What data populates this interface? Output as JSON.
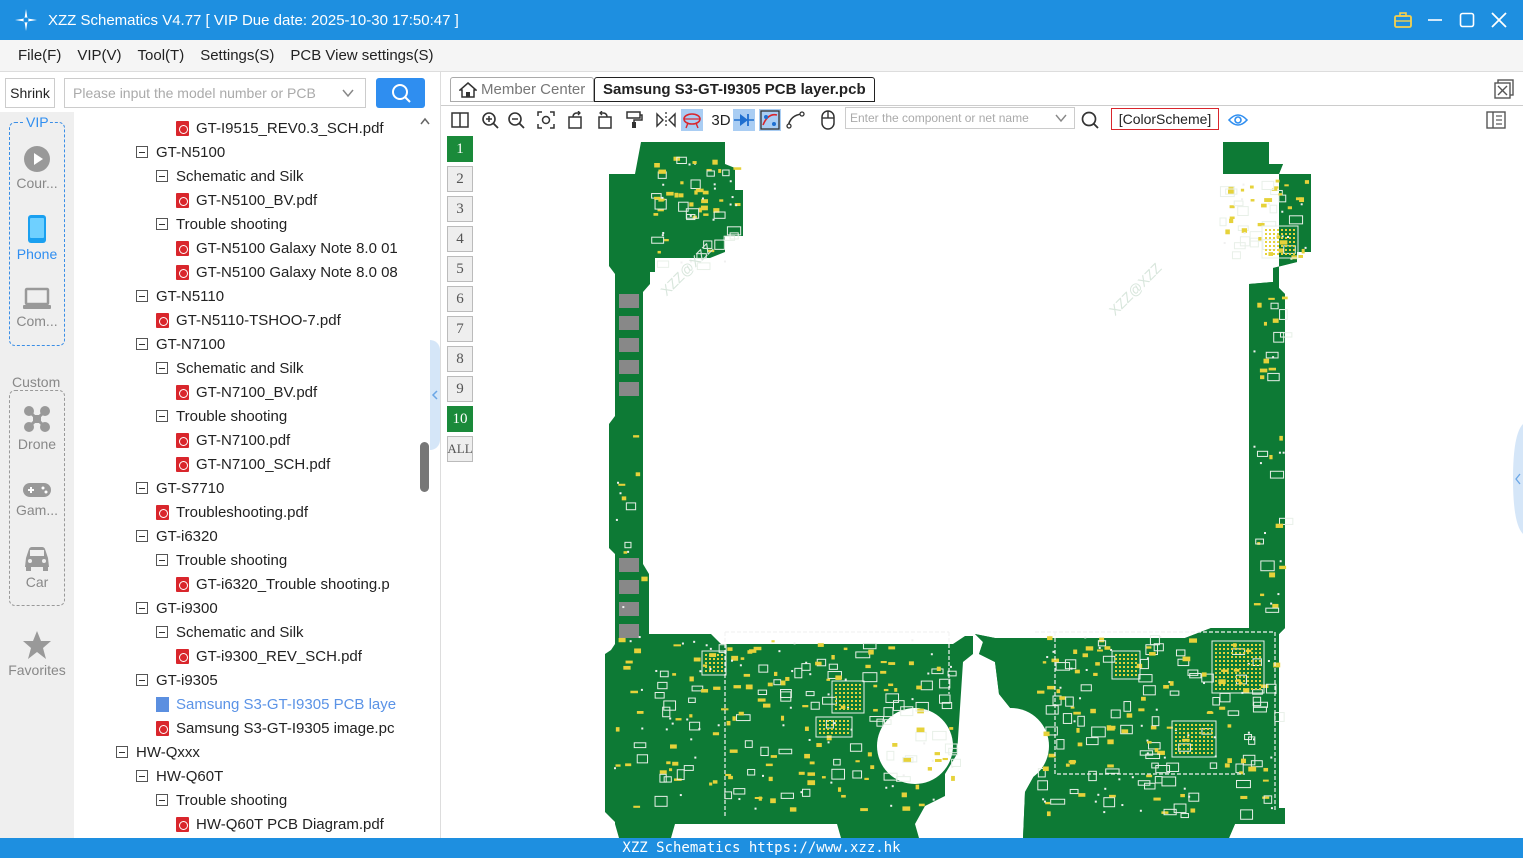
{
  "window": {
    "title": "XZZ Schematics V4.77 [ VIP Due date: 2025-10-30 17:50:47 ]"
  },
  "menu": [
    "File(F)",
    "VIP(V)",
    "Tool(T)",
    "Settings(S)",
    "PCB View settings(S)"
  ],
  "left": {
    "shrink_label": "Shrink",
    "search_placeholder": "Please input the model number or PCB",
    "vip_label": "VIP",
    "custom_label": "Custom",
    "categories": [
      {
        "label": "Cour...",
        "icon": "play-icon"
      },
      {
        "label": "Phone",
        "icon": "phone-icon"
      },
      {
        "label": "Com...",
        "icon": "laptop-icon"
      },
      {
        "label": "Drone",
        "icon": "drone-icon"
      },
      {
        "label": "Gam...",
        "icon": "gamepad-icon"
      },
      {
        "label": "Car",
        "icon": "car-icon"
      },
      {
        "label": "Favorites",
        "icon": "star-icon"
      }
    ],
    "tree": [
      {
        "text": "GT-I9515_REV0.3_SCH.pdf",
        "level": 3,
        "kind": "pdf"
      },
      {
        "text": "GT-N5100",
        "level": 1,
        "kind": "folder"
      },
      {
        "text": "Schematic and Silk",
        "level": 2,
        "kind": "folder"
      },
      {
        "text": "GT-N5100_BV.pdf",
        "level": 3,
        "kind": "pdf"
      },
      {
        "text": "Trouble shooting",
        "level": 2,
        "kind": "folder"
      },
      {
        "text": "GT-N5100 Galaxy Note 8.0 01",
        "level": 3,
        "kind": "pdf"
      },
      {
        "text": "GT-N5100 Galaxy Note 8.0 08",
        "level": 3,
        "kind": "pdf"
      },
      {
        "text": "GT-N5110",
        "level": 1,
        "kind": "folder"
      },
      {
        "text": "GT-N5110-TSHOO-7.pdf",
        "level": 2,
        "kind": "pdf"
      },
      {
        "text": "GT-N7100",
        "level": 1,
        "kind": "folder"
      },
      {
        "text": "Schematic and Silk",
        "level": 2,
        "kind": "folder"
      },
      {
        "text": "GT-N7100_BV.pdf",
        "level": 3,
        "kind": "pdf"
      },
      {
        "text": "Trouble shooting",
        "level": 2,
        "kind": "folder"
      },
      {
        "text": "GT-N7100.pdf",
        "level": 3,
        "kind": "pdf"
      },
      {
        "text": "GT-N7100_SCH.pdf",
        "level": 3,
        "kind": "pdf"
      },
      {
        "text": "GT-S7710",
        "level": 1,
        "kind": "folder"
      },
      {
        "text": "Troubleshooting.pdf",
        "level": 2,
        "kind": "pdf"
      },
      {
        "text": "GT-i6320",
        "level": 1,
        "kind": "folder"
      },
      {
        "text": "Trouble shooting",
        "level": 2,
        "kind": "folder"
      },
      {
        "text": "GT-i6320_Trouble shooting.p",
        "level": 3,
        "kind": "pdf"
      },
      {
        "text": "GT-i9300",
        "level": 1,
        "kind": "folder"
      },
      {
        "text": "Schematic and Silk",
        "level": 2,
        "kind": "folder"
      },
      {
        "text": "GT-i9300_REV_SCH.pdf",
        "level": 3,
        "kind": "pdf"
      },
      {
        "text": "GT-i9305",
        "level": 1,
        "kind": "folder"
      },
      {
        "text": "Samsung S3-GT-I9305 PCB laye",
        "level": 2,
        "kind": "pcb",
        "selected": true
      },
      {
        "text": "Samsung S3-GT-I9305 image.pc",
        "level": 2,
        "kind": "pdf"
      },
      {
        "text": "HW-Qxxx",
        "level": 0,
        "kind": "folder"
      },
      {
        "text": "HW-Q60T",
        "level": 1,
        "kind": "folder"
      },
      {
        "text": "Trouble shooting",
        "level": 2,
        "kind": "folder"
      },
      {
        "text": "HW-Q60T PCB Diagram.pdf",
        "level": 3,
        "kind": "pdf"
      }
    ]
  },
  "tabs": {
    "member_center": "Member Center",
    "active": "Samsung S3-GT-I9305 PCB layer.pcb"
  },
  "toolbar": {
    "label_3d": "3D",
    "search_placeholder": "Enter the component or net name",
    "color_scheme": "[ColorScheme]"
  },
  "layers": [
    "1",
    "2",
    "3",
    "4",
    "5",
    "6",
    "7",
    "8",
    "9",
    "10",
    "ALL"
  ],
  "canvas": {
    "watermark": "XZZ@XZZ"
  },
  "status": "XZZ Schematics https://www.xzz.hk",
  "colors": {
    "accent": "#1e8fe0",
    "pcb_green": "#0d7a35",
    "pad_yellow": "#e6d23a",
    "layer_active": "#1a8a3a"
  }
}
